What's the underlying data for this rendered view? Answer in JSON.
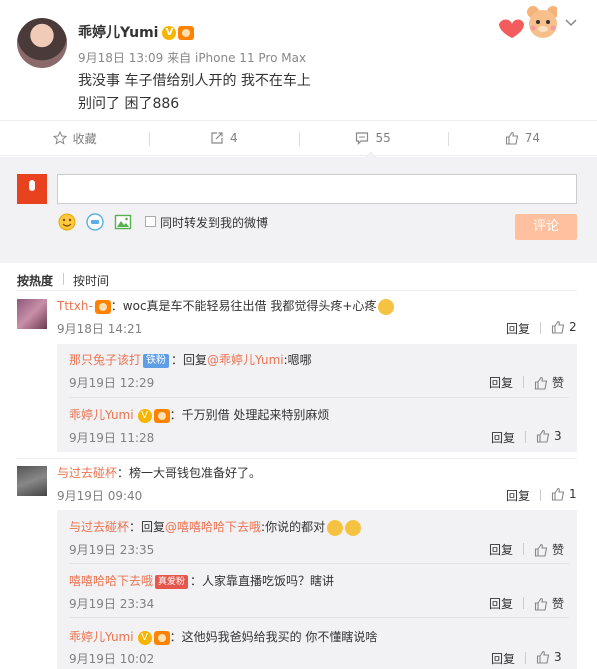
{
  "post": {
    "author": "乖婷儿Yumi",
    "date": "9月18日 13:09",
    "source_prefix": "来自",
    "source": "iPhone 11 Pro Max",
    "text_line1": "我没事 车子借给别人开的 我不在车上",
    "text_line2": "别问了 困了886"
  },
  "actions": {
    "favorite_label": "收藏",
    "repost_count": "4",
    "comment_count": "55",
    "like_count": "74"
  },
  "composer": {
    "input_value": "",
    "repost_checkbox_label": "同时转发到我的微博",
    "submit_label": "评论"
  },
  "sort": {
    "hot": "按热度",
    "time": "按时间"
  },
  "comments": [
    {
      "name": "Tttxh-",
      "text": "：woc真是车不能轻易往出借 我都觉得头疼+心疼",
      "time": "9月18日 14:21",
      "reply": "回复",
      "likes": "2",
      "replies": [
        {
          "name": "那只兔子该打",
          "badge": "铁粉",
          "prefix": "：回复",
          "mention": "@乖婷儿Yumi",
          "text": ":嗯哪",
          "time": "9月19日 12:29",
          "reply": "回复",
          "likes": "赞"
        },
        {
          "name": "乖婷儿Yumi",
          "text": "：千万别借 处理起来特别麻烦",
          "time": "9月19日 11:28",
          "reply": "回复",
          "likes": "3"
        }
      ]
    },
    {
      "name": "与过去碰杯",
      "text": "：榜一大哥钱包准备好了。",
      "time": "9月19日 09:40",
      "reply": "回复",
      "likes": "1",
      "replies": [
        {
          "name": "与过去碰杯",
          "prefix": "：回复",
          "mention": "@嘻嘻哈哈下去哦",
          "text": ":你说的都对",
          "time": "9月19日 23:35",
          "reply": "回复",
          "likes": "赞"
        },
        {
          "name": "嘻嘻哈哈下去哦",
          "badge": "真爱粉",
          "text": "：人家靠直播吃饭吗？瞎讲",
          "time": "9月19日 23:34",
          "reply": "回复",
          "likes": "赞"
        },
        {
          "name": "乖婷儿Yumi",
          "text": "：这他妈我爸妈给我买的 你不懂瞎说啥",
          "time": "9月19日 10:02",
          "reply": "回复",
          "likes": "3"
        }
      ]
    }
  ]
}
